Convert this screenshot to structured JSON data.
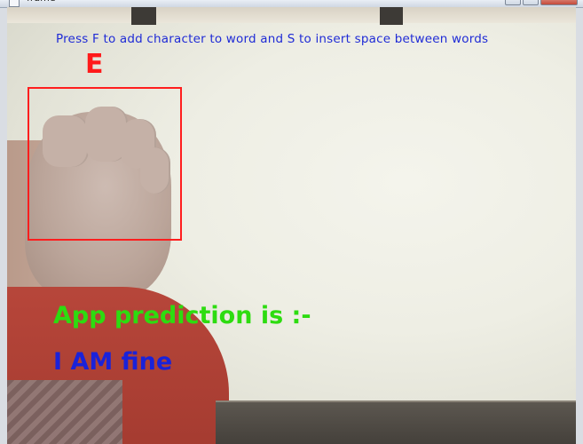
{
  "window": {
    "title": "frame"
  },
  "overlay": {
    "instructions": "Press F to add character to word and S to insert space between words",
    "current_letter": "E",
    "prediction_label": "App prediction is :-",
    "prediction_text": "I AM fine"
  },
  "colors": {
    "instructions": "#1f2bd6",
    "current_letter": "#ff1a1a",
    "roi_box": "#ff1e1e",
    "prediction_label": "#2ddc10",
    "prediction_text": "#1a22d9"
  }
}
